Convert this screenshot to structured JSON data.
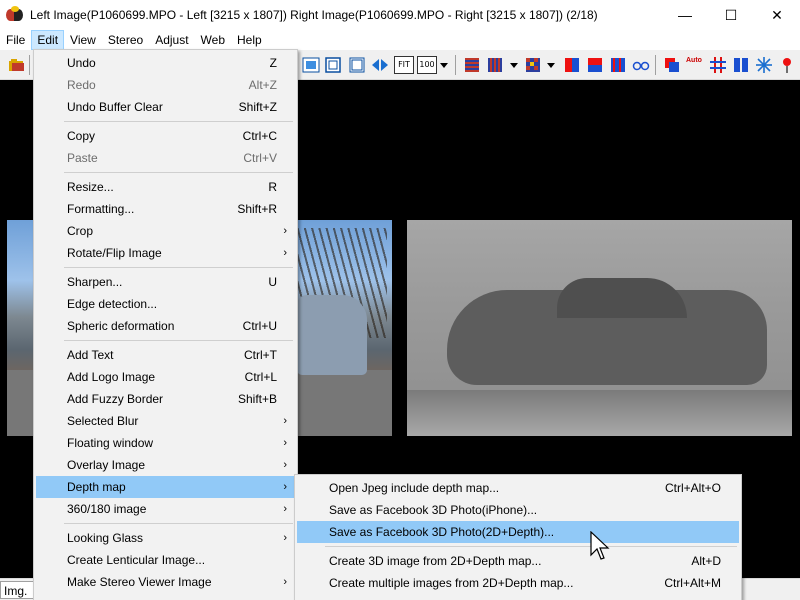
{
  "window": {
    "title": "Left Image(P1060699.MPO - Left [3215 x 1807]) Right Image(P1060699.MPO - Right [3215 x 1807])  (2/18)",
    "minimize": "—",
    "maximize": "☐",
    "close": "✕"
  },
  "menubar": [
    "File",
    "Edit",
    "View",
    "Stereo",
    "Adjust",
    "Web",
    "Help"
  ],
  "edit_menu": {
    "items": [
      {
        "label": "Undo",
        "shortcut": "Z"
      },
      {
        "label": "Redo",
        "shortcut": "Alt+Z"
      },
      {
        "label": "Undo Buffer Clear",
        "shortcut": "Shift+Z"
      },
      {
        "label": "Copy",
        "shortcut": "Ctrl+C"
      },
      {
        "label": "Paste",
        "shortcut": "Ctrl+V"
      },
      {
        "label": "Resize...",
        "shortcut": "R"
      },
      {
        "label": "Formatting...",
        "shortcut": "Shift+R"
      },
      {
        "label": "Crop",
        "arrow": "›"
      },
      {
        "label": "Rotate/Flip Image",
        "arrow": "›"
      },
      {
        "label": "Sharpen...",
        "shortcut": "U"
      },
      {
        "label": "Edge detection..."
      },
      {
        "label": "Spheric deformation",
        "shortcut": "Ctrl+U"
      },
      {
        "label": "Add Text",
        "shortcut": "Ctrl+T"
      },
      {
        "label": "Add Logo Image",
        "shortcut": "Ctrl+L"
      },
      {
        "label": "Add Fuzzy Border",
        "shortcut": "Shift+B"
      },
      {
        "label": "Selected Blur",
        "arrow": "›"
      },
      {
        "label": "Floating window",
        "arrow": "›"
      },
      {
        "label": "Overlay Image",
        "arrow": "›"
      },
      {
        "label": "Depth map",
        "arrow": "›"
      },
      {
        "label": "360/180 image",
        "arrow": "›"
      },
      {
        "label": "Looking Glass",
        "arrow": "›"
      },
      {
        "label": "Create Lenticular Image..."
      },
      {
        "label": "Make Stereo Viewer Image",
        "arrow": "›"
      }
    ]
  },
  "depth_submenu": {
    "items": [
      {
        "label": "Open Jpeg include depth map...",
        "shortcut": "Ctrl+Alt+O"
      },
      {
        "label": "Save as Facebook 3D Photo(iPhone)..."
      },
      {
        "label": "Save as Facebook 3D Photo(2D+Depth)..."
      },
      {
        "label": "Create 3D image from 2D+Depth map...",
        "shortcut": "Alt+D"
      },
      {
        "label": "Create multiple images from 2D+Depth map...",
        "shortcut": "Ctrl+Alt+M"
      }
    ]
  },
  "statusbar": {
    "left": "Img. S"
  },
  "toolbar_labels": {
    "fit": "FIT",
    "hundred": "100",
    "auto": "Auto"
  }
}
